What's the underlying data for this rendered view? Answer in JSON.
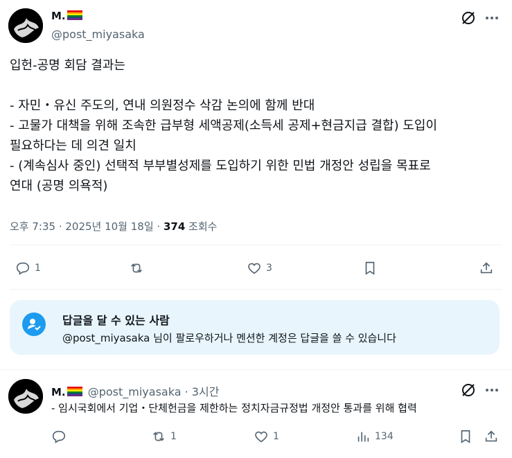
{
  "tweet": {
    "name": "M.",
    "handle": "@post_miyasaka",
    "lines": [
      "입헌-공명 회담 결과는",
      "",
      "- 자민・유신 주도의, 연내 의원정수 삭감 논의에 함께 반대",
      "- 고물가 대책을 위해 조속한 급부형 세액공제(소득세 공제+현금지급 결합) 도입이",
      "필요하다는 데 의견 일치",
      "- (계속심사 중인) 선택적 부부별성제를 도입하기 위한 민법 개정안 성립을 목표로",
      "연대 (공명 의욕적)"
    ],
    "timestamp": "오후 7:35 · 2025년 10월 18일 · ",
    "views_count": "374",
    "views_label": " 조회수",
    "actions": {
      "replies": "1",
      "reposts": "",
      "likes": "3"
    }
  },
  "reply_permission": {
    "title": "답글을 달 수 있는 사람",
    "desc": "@post_miyasaka 님이 팔로우하거나 멘션한 계정은 답글을 쓸 수 있습니다"
  },
  "reply": {
    "name": "M.",
    "handle_time": "@post_miyasaka · 3시간",
    "text": "- 임시국회에서 기업・단체헌금을 제한하는 정치자금규정법 개정안 통과를 위해 협력",
    "actions": {
      "replies": "",
      "reposts": "1",
      "likes": "1",
      "views": "134"
    }
  },
  "icons": [
    "grok-icon",
    "more-icon",
    "reply-icon",
    "repost-icon",
    "like-icon",
    "bookmark-icon",
    "share-icon",
    "views-icon",
    "person-check-icon"
  ],
  "colors": {
    "accent": "#1d9bf0",
    "secondary_text": "#536471",
    "reply_box_bg": "#e8f5fd"
  }
}
